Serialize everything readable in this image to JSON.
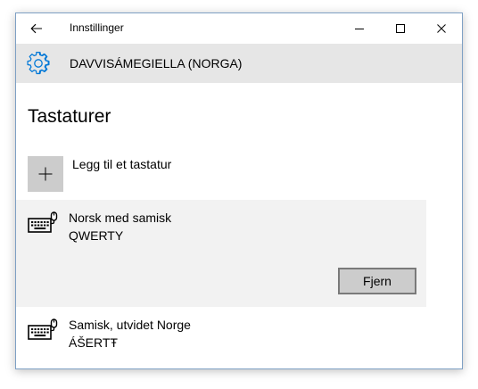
{
  "window": {
    "title": "Innstillinger"
  },
  "header": {
    "title": "DAVVISÁMEGIELLA (NORGA)"
  },
  "section": {
    "title": "Tastaturer"
  },
  "add_keyboard": {
    "label": "Legg til et tastatur"
  },
  "keyboards": [
    {
      "name": "Norsk med samisk",
      "layout": "QWERTY",
      "selected": true,
      "remove_label": "Fjern"
    },
    {
      "name": "Samisk, utvidet Norge",
      "layout": "ÁŠERTŦ",
      "selected": false
    }
  ],
  "icons": {
    "back": "back-arrow-icon",
    "minimize": "minimize-icon",
    "maximize": "maximize-icon",
    "close": "close-icon",
    "settings": "gear-icon",
    "add": "plus-icon",
    "keyboard": "keyboard-icon"
  },
  "colors": {
    "accent": "#0078d7",
    "header_band": "#e6e6e6",
    "selected_item": "#f2f2f2",
    "button": "#cccccc"
  }
}
